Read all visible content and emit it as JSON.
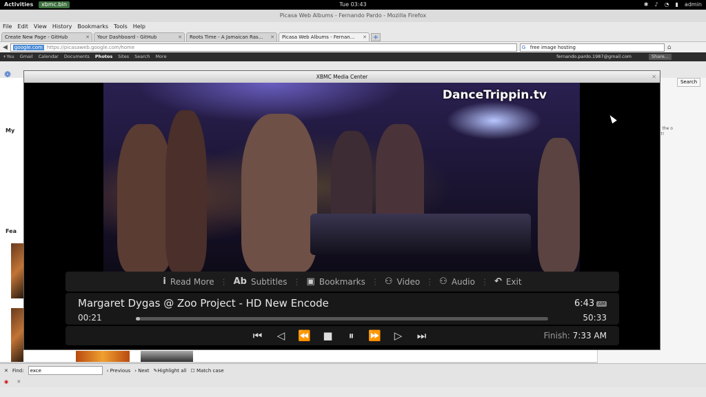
{
  "topbar": {
    "activities": "Activities",
    "app": "xbmc.bin",
    "clock": "Tue 03:43",
    "user": "admin"
  },
  "firefox": {
    "window_title": "Picasa Web Albums - Fernando Pardo - Mozilla Firefox",
    "menu": [
      "File",
      "Edit",
      "View",
      "History",
      "Bookmarks",
      "Tools",
      "Help"
    ],
    "tabs": [
      {
        "label": "Create New Page - GitHub"
      },
      {
        "label": "Your Dashboard - GitHub"
      },
      {
        "label": "Roots Time - A Jamaican Ras..."
      },
      {
        "label": "Picasa Web Albums - Fernan..."
      }
    ],
    "new_tab": "+",
    "url_domain": "google.com",
    "url": "https://picasaweb.google.com/home",
    "search_value": "free image hosting",
    "googlebar": [
      "+You",
      "Gmail",
      "Calendar",
      "Documents",
      "Photos",
      "Sites",
      "Search",
      "More"
    ],
    "googlebar_active": "Photos",
    "account": "fernando.pardo.1987@gmail.com",
    "share": "Share...",
    "search_button": "Search",
    "promo_title": "oader",
    "promo_text": "moved the o support!",
    "label_my": "My",
    "label_featured": "Fea",
    "find": {
      "label": "Find:",
      "value": "exce",
      "previous": "Previous",
      "next": "Next",
      "highlight": "Highlight all",
      "match_case": "Match case"
    }
  },
  "xbmc": {
    "window_title": "XBMC Media Center",
    "watermark": "DanceTrippin.tv",
    "menu": [
      {
        "icon": "i",
        "label": "Read More"
      },
      {
        "icon": "Ab",
        "label": "Subtitles"
      },
      {
        "icon": "▣",
        "label": "Bookmarks"
      },
      {
        "icon": "⚇",
        "label": "Video"
      },
      {
        "icon": "⚇",
        "label": "Audio"
      },
      {
        "icon": "↶",
        "label": "Exit"
      }
    ],
    "now_playing": "Margaret Dygas @ Zoo Project - HD New Encode",
    "clock": "6:43",
    "ampm": "AM",
    "elapsed": "00:21",
    "total": "50:33",
    "progress_fraction": 0.007,
    "controls": [
      {
        "name": "skip-back",
        "glyph": "⏮"
      },
      {
        "name": "prev",
        "glyph": "◁"
      },
      {
        "name": "rewind",
        "glyph": "⏪"
      },
      {
        "name": "stop",
        "glyph": "■"
      },
      {
        "name": "pause",
        "glyph": "⏸"
      },
      {
        "name": "fast-forward",
        "glyph": "⏩"
      },
      {
        "name": "next",
        "glyph": "▷"
      },
      {
        "name": "skip-forward",
        "glyph": "⏭"
      }
    ],
    "finish_label": "Finish:",
    "finish_time": "7:33 AM"
  }
}
